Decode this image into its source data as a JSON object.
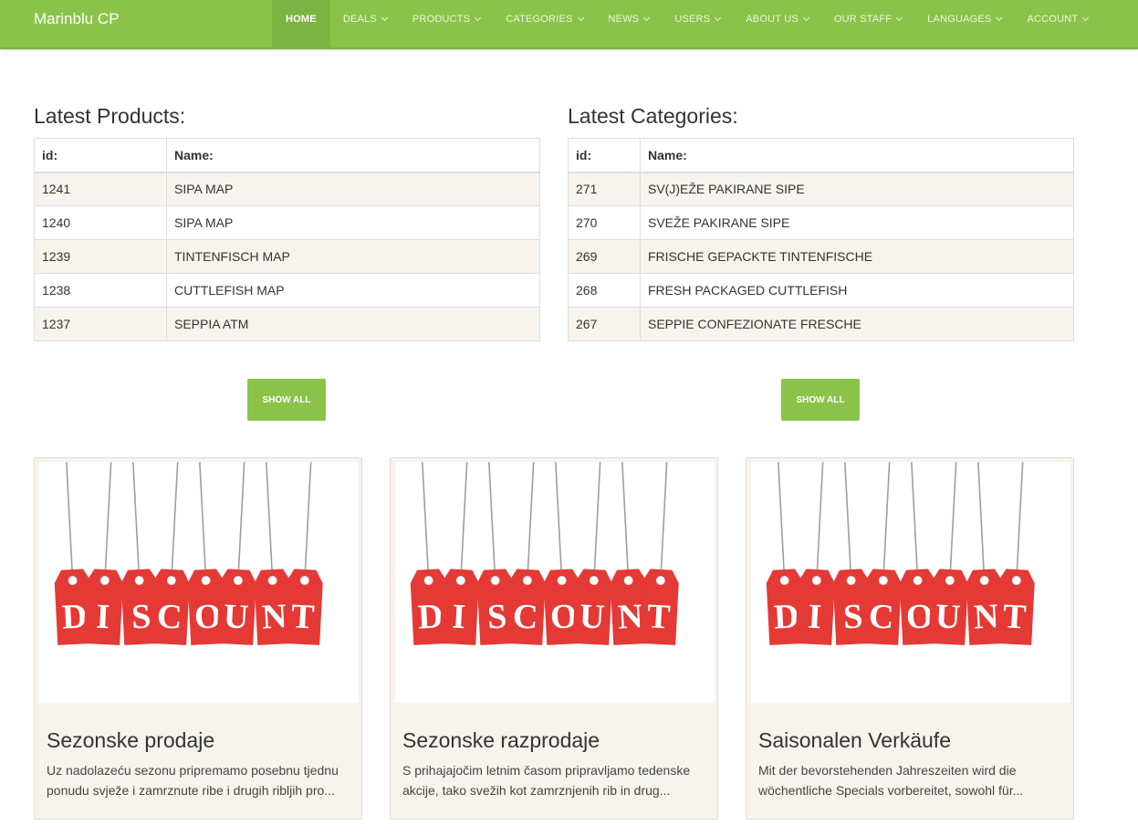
{
  "navbar": {
    "brand": "Marinblu CP",
    "items": [
      {
        "label": "HOME",
        "active": true,
        "dropdown": false
      },
      {
        "label": "DEALS",
        "active": false,
        "dropdown": true
      },
      {
        "label": "PRODUCTS",
        "active": false,
        "dropdown": true
      },
      {
        "label": "CATEGORIES",
        "active": false,
        "dropdown": true
      },
      {
        "label": "NEWS",
        "active": false,
        "dropdown": true
      },
      {
        "label": "USERS",
        "active": false,
        "dropdown": true
      },
      {
        "label": "ABOUT US",
        "active": false,
        "dropdown": true
      },
      {
        "label": "OUR STAFF",
        "active": false,
        "dropdown": true
      },
      {
        "label": "LANGUAGES",
        "active": false,
        "dropdown": true
      },
      {
        "label": "ACCOUNT",
        "active": false,
        "dropdown": true
      }
    ]
  },
  "products": {
    "title": "Latest Products:",
    "headers": {
      "id": "id:",
      "name": "Name:"
    },
    "rows": [
      {
        "id": "1241",
        "name": "SIPA MAP"
      },
      {
        "id": "1240",
        "name": "SIPA MAP"
      },
      {
        "id": "1239",
        "name": "TINTENFISCH MAP"
      },
      {
        "id": "1238",
        "name": "CUTTLEFISH MAP"
      },
      {
        "id": "1237",
        "name": "SEPPIA ATM"
      }
    ],
    "button": "SHOW ALL"
  },
  "categories": {
    "title": "Latest Categories:",
    "headers": {
      "id": "id:",
      "name": "Name:"
    },
    "rows": [
      {
        "id": "271",
        "name": "SV(J)EŽE PAKIRANE SIPE"
      },
      {
        "id": "270",
        "name": "SVEŽE PAKIRANE SIPE"
      },
      {
        "id": "269",
        "name": "FRISCHE GEPACKTE TINTENFISCHE"
      },
      {
        "id": "268",
        "name": "FRESH PACKAGED CUTTLEFISH"
      },
      {
        "id": "267",
        "name": "SEPPIE CONFEZIONATE FRESCHE"
      }
    ],
    "button": "SHOW ALL"
  },
  "deals": [
    {
      "image_word": "DISCOUNT",
      "title": "Sezonske prodaje",
      "text": "Uz nadolazeću sezonu pripremamo posebnu tjednu ponudu svježe i zamrznute ribe i drugih ribljih pro..."
    },
    {
      "image_word": "DISCOUNT",
      "title": "Sezonske razprodaje",
      "text": "S prihajajočim letnim časom pripravljamo tedenske akcije, tako svežih kot zamrznjenih rib in drug..."
    },
    {
      "image_word": "DISCOUNT",
      "title": "Saisonalen Verkäufe",
      "text": "Mit der bevorstehenden Jahreszeiten wird die wöchentliche Specials vorbereitet, sowohl für..."
    }
  ],
  "colors": {
    "brand_green": "#8bc34a",
    "tag_red": "#e53935",
    "card_bg": "#f7f4ee"
  }
}
